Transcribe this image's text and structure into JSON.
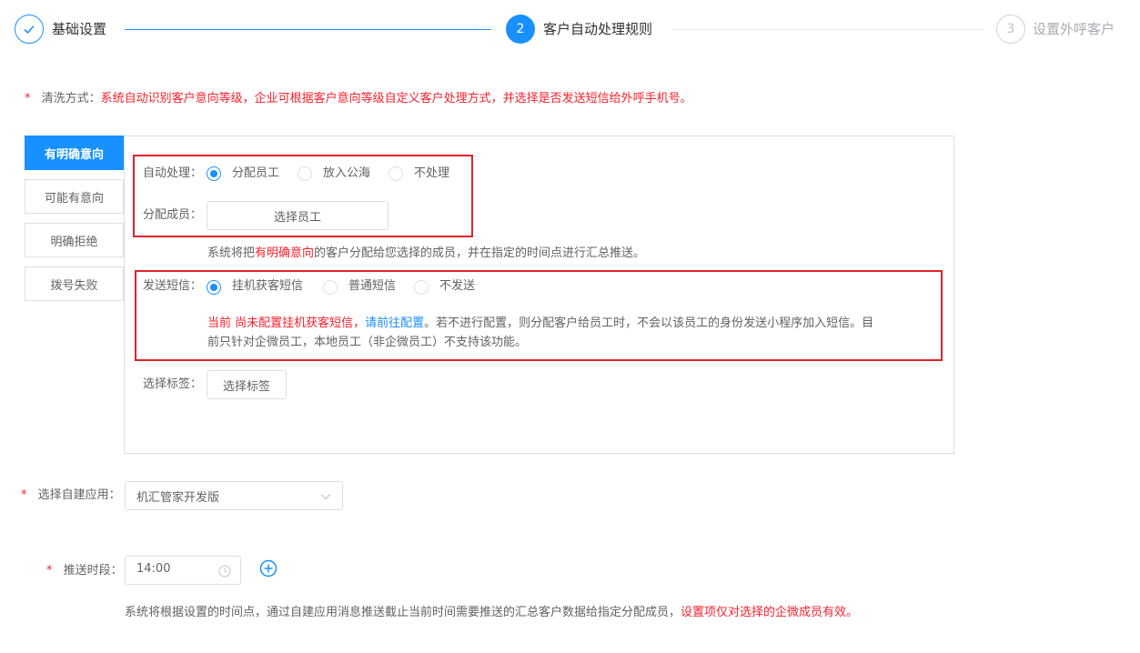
{
  "steps": [
    {
      "num": "",
      "label": "基础设置",
      "state": "done"
    },
    {
      "num": "2",
      "label": "客户自动处理规则",
      "state": "active"
    },
    {
      "num": "3",
      "label": "设置外呼客户",
      "state": "wait"
    }
  ],
  "wash": {
    "star": "*",
    "label": "清洗方式：",
    "desc": "系统自动识别客户意向等级，企业可根据客户意向等级自定义客户处理方式，并选择是否发送短信给外呼手机号。"
  },
  "tabs": [
    "有明确意向",
    "可能有意向",
    "明确拒绝",
    "拨号失败"
  ],
  "auto": {
    "label": "自动处理：",
    "options": [
      "分配员工",
      "放入公海",
      "不处理"
    ],
    "selected": 0
  },
  "assign": {
    "label": "分配成员：",
    "button": "选择员工",
    "hint_pre": "系统将把",
    "hint_highlight": "有明确意向",
    "hint_post": "的客户分配给您选择的成员，并在指定的时间点进行汇总推送。"
  },
  "sms": {
    "label": "发送短信：",
    "options": [
      "挂机获客短信",
      "普通短信",
      "不发送"
    ],
    "selected": 0,
    "warn_red": "当前 尚未配置挂机获客短信，",
    "warn_link": "请前往配置",
    "warn_line1": "。若不进行配置，则分配客户给员工时，不会以该员工的身份发送小程序加入短信。目",
    "warn_line2": "前只针对企微员工，本地员工（非企微员工）不支持该功能。"
  },
  "tag": {
    "label": "选择标签：",
    "button": "选择标签"
  },
  "app": {
    "star": "*",
    "label": "选择自建应用：",
    "value": "机汇管家开发版"
  },
  "push": {
    "star": "*",
    "label": "推送时段：",
    "time": "14:00",
    "note_pre": "系统将根据设置的时间点，通过自建应用消息推送截止当前时间需要推送的汇总客户数据给指定分配成员，",
    "note_red": "设置项仅对选择的企微成员有效。"
  },
  "colors": {
    "primary": "#1890ff",
    "danger": "#f5222d",
    "highlight_box": "#e0242a"
  }
}
